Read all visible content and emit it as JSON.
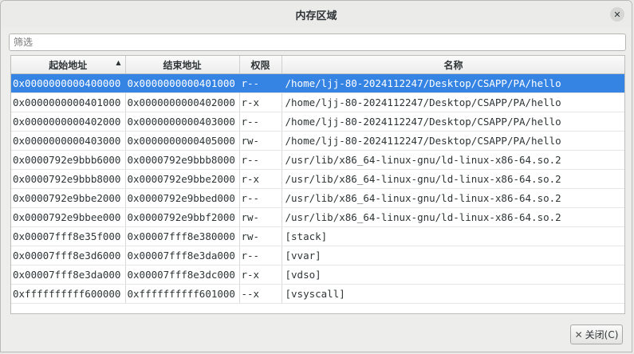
{
  "window": {
    "title": "内存区域",
    "close_glyph": "✕"
  },
  "filter": {
    "placeholder": "筛选"
  },
  "table": {
    "columns": [
      "起始地址",
      "结束地址",
      "权限",
      "名称"
    ],
    "sort_column": 0,
    "sort_glyph": "▲",
    "selected_row": 0,
    "rows": [
      [
        "0x0000000000400000",
        "0x0000000000401000",
        "r--",
        "/home/ljj-80-2024112247/Desktop/CSAPP/PA/hello"
      ],
      [
        "0x0000000000401000",
        "0x0000000000402000",
        "r-x",
        "/home/ljj-80-2024112247/Desktop/CSAPP/PA/hello"
      ],
      [
        "0x0000000000402000",
        "0x0000000000403000",
        "r--",
        "/home/ljj-80-2024112247/Desktop/CSAPP/PA/hello"
      ],
      [
        "0x0000000000403000",
        "0x0000000000405000",
        "rw-",
        "/home/ljj-80-2024112247/Desktop/CSAPP/PA/hello"
      ],
      [
        "0x0000792e9bbb6000",
        "0x0000792e9bbb8000",
        "r--",
        "/usr/lib/x86_64-linux-gnu/ld-linux-x86-64.so.2"
      ],
      [
        "0x0000792e9bbb8000",
        "0x0000792e9bbe2000",
        "r-x",
        "/usr/lib/x86_64-linux-gnu/ld-linux-x86-64.so.2"
      ],
      [
        "0x0000792e9bbe2000",
        "0x0000792e9bbed000",
        "r--",
        "/usr/lib/x86_64-linux-gnu/ld-linux-x86-64.so.2"
      ],
      [
        "0x0000792e9bbee000",
        "0x0000792e9bbf2000",
        "rw-",
        "/usr/lib/x86_64-linux-gnu/ld-linux-x86-64.so.2"
      ],
      [
        "0x00007fff8e35f000",
        "0x00007fff8e380000",
        "rw-",
        "[stack]"
      ],
      [
        "0x00007fff8e3d6000",
        "0x00007fff8e3da000",
        "r--",
        "[vvar]"
      ],
      [
        "0x00007fff8e3da000",
        "0x00007fff8e3dc000",
        "r-x",
        "[vdso]"
      ],
      [
        "0xffffffffff600000",
        "0xffffffffff601000",
        "--x",
        "[vsyscall]"
      ]
    ]
  },
  "footer": {
    "close_glyph": "✕",
    "close_label": "关闭(C)"
  }
}
